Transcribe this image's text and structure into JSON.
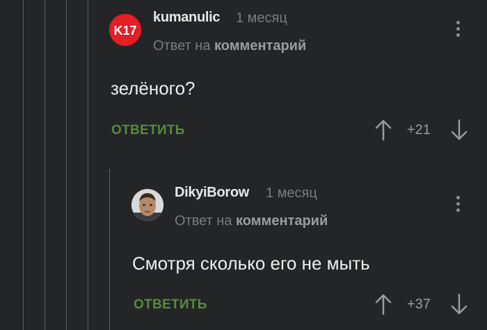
{
  "thread": {
    "comments": [
      {
        "username": "kumanulic",
        "time": "1 месяц",
        "reply_prefix": "Ответ на",
        "reply_link": "комментарий",
        "text": "зелёного?",
        "reply_label": "ОТВЕТИТЬ",
        "score": "+21",
        "avatar_text": "K17",
        "avatar_color": "#e31e24"
      },
      {
        "username": "DikyiBorow",
        "time": "1 месяц",
        "reply_prefix": "Ответ на",
        "reply_link": "комментарий",
        "text": "Смотря сколько его не мыть",
        "reply_label": "ОТВЕТИТЬ",
        "score": "+37"
      }
    ]
  },
  "colors": {
    "background": "#232527",
    "accent_green": "#5a8a3c",
    "thread_line": "#5b5e61"
  },
  "icons": [
    "more-vertical-icon",
    "arrow-up-icon",
    "arrow-down-icon"
  ]
}
